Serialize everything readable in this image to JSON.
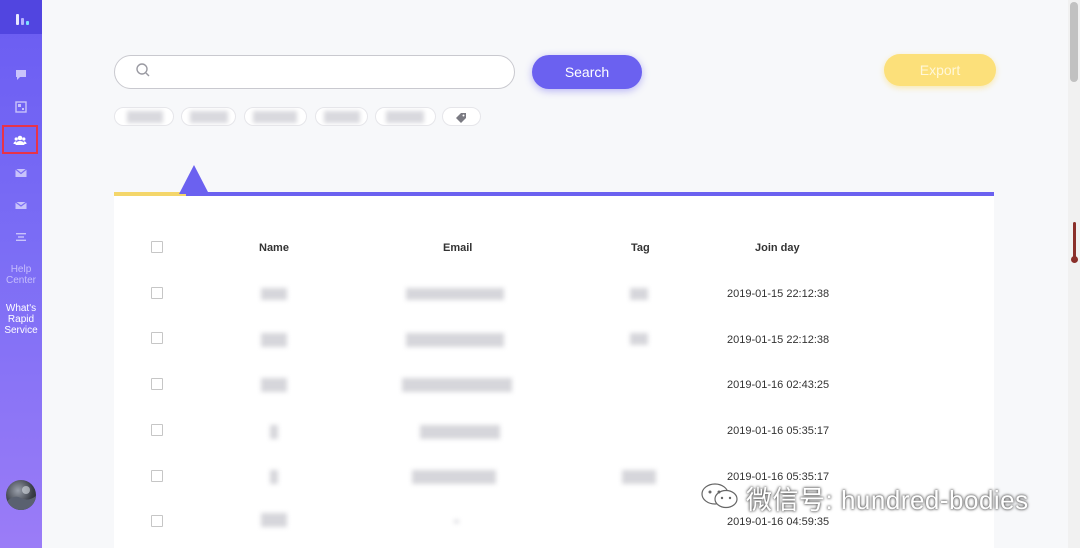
{
  "sidebar": {
    "items": [
      {
        "icon": "chat-icon"
      },
      {
        "icon": "layout-icon"
      },
      {
        "icon": "users-icon",
        "active": true
      },
      {
        "icon": "mail-icon"
      },
      {
        "icon": "mail-open-icon"
      },
      {
        "icon": "menu-icon"
      }
    ],
    "help_label": "Help Center",
    "whats_label": "What's Rapid Service"
  },
  "search": {
    "placeholder": "",
    "button_label": "Search"
  },
  "export_label": "Export",
  "table": {
    "columns": [
      "Name",
      "Email",
      "Tag",
      "Join day"
    ],
    "rows": [
      {
        "join_day": "2019-01-15 22:12:38"
      },
      {
        "join_day": "2019-01-15 22:12:38"
      },
      {
        "join_day": "2019-01-16 02:43:25"
      },
      {
        "join_day": "2019-01-16 05:35:17"
      },
      {
        "join_day": "2019-01-16 05:35:17"
      },
      {
        "join_day": "2019-01-16 04:59:35"
      }
    ]
  },
  "watermark": "微信号: hundred-bodies",
  "colors": {
    "accent": "#6b61f0",
    "export": "#fce07a",
    "sidebar_top": "#6a5cf2",
    "active_outline": "#e8334a"
  }
}
